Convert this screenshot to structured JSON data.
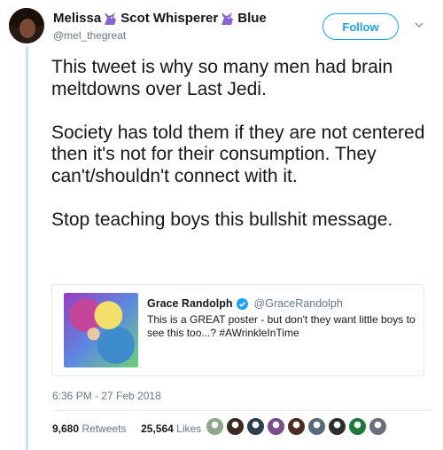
{
  "author": {
    "display_name_part1": "Melissa",
    "display_name_part2": "Scot Whisperer",
    "display_name_part3": "Blue",
    "handle": "@mel_thegreat"
  },
  "follow_label": "Follow",
  "tweet": {
    "paragraph1": "This tweet is why so many men had brain meltdowns over Last Jedi.",
    "paragraph2": "Society has told them if they are not centered then it's not for their consumption. They can't/shouldn't connect with it.",
    "paragraph3": "Stop teaching boys this bullshit message."
  },
  "quoted": {
    "name": "Grace Randolph",
    "handle": "@GraceRandolph",
    "text": "This is a GREAT poster - but don't they want little boys to see this too...? #AWrinkleInTime"
  },
  "timestamp": "6:36 PM - 27 Feb 2018",
  "stats": {
    "retweets_count": "9,680",
    "retweets_label": "Retweets",
    "likes_count": "25,564",
    "likes_label": "Likes"
  },
  "likers": [
    "#8fa88a",
    "#3a2a22",
    "#2c3e50",
    "#7b4b8a",
    "#4b2e20",
    "#556b7a",
    "#2e2e2e",
    "#1e7a3c",
    "#6b6f7a"
  ],
  "colors": {
    "accent": "#1da1f2",
    "thread_line": "#c4e4f5",
    "unicorn": "#8a63d2"
  }
}
